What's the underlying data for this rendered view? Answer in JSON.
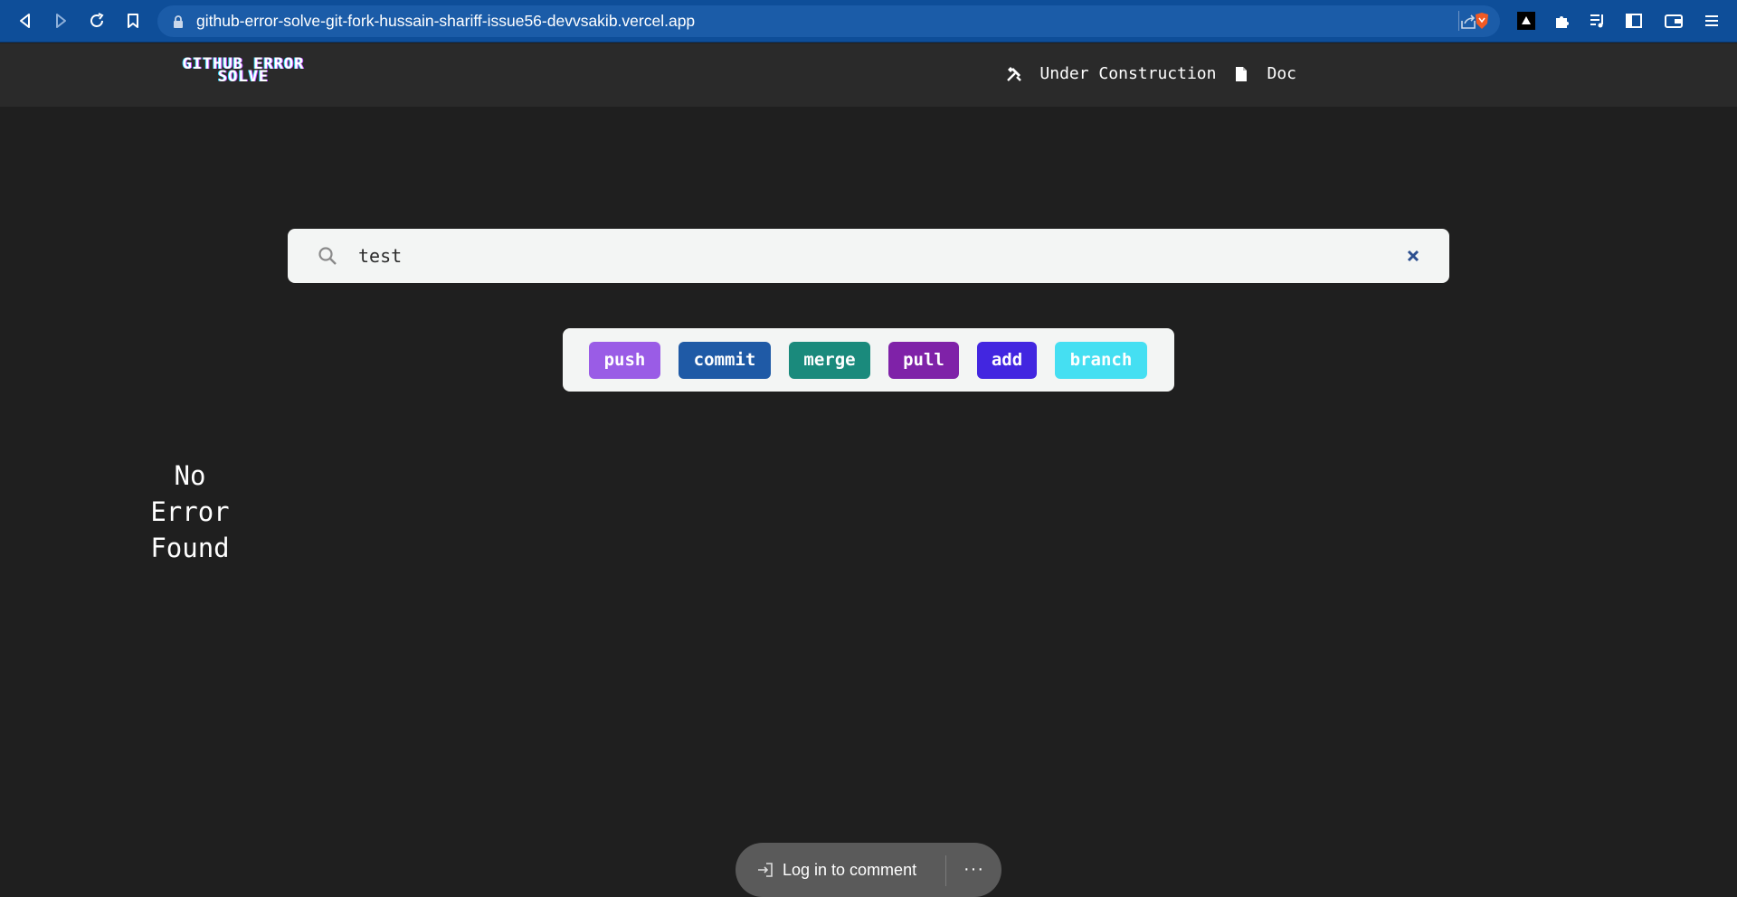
{
  "browser": {
    "url": "github-error-solve-git-fork-hussain-shariff-issue56-devvsakib.vercel.app"
  },
  "header": {
    "logo_line1": "GITHUB ERROR",
    "logo_line2": "SOLVE",
    "nav": [
      {
        "label": "Under Construction",
        "icon": "tools-icon"
      },
      {
        "label": "Doc",
        "icon": "document-icon"
      }
    ]
  },
  "search": {
    "value": "test",
    "placeholder": "Search"
  },
  "tags": [
    {
      "label": "push",
      "color": "#9a5ce6"
    },
    {
      "label": "commit",
      "color": "#1f5aa6"
    },
    {
      "label": "merge",
      "color": "#1a8a7c"
    },
    {
      "label": "pull",
      "color": "#7f22a8"
    },
    {
      "label": "add",
      "color": "#4226e0"
    },
    {
      "label": "branch",
      "color": "#45dff2"
    }
  ],
  "result": {
    "line1": "No",
    "line2": "Error",
    "line3": "Found"
  },
  "comment_bar": {
    "login_label": "Log in to comment",
    "more_label": "···"
  }
}
